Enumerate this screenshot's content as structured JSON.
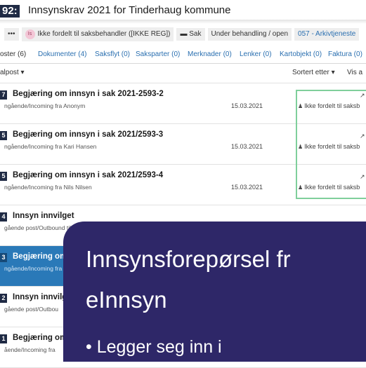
{
  "header": {
    "case_id": "92:",
    "title": "Innsynskrav 2021 for Tinderhaug kommune"
  },
  "meta": {
    "dots": "•••",
    "avatar_initials": "Is",
    "assignee": "Ikke fordelt til saksbehandler ([IKKE REG])",
    "type_icon": "folder-icon",
    "type": "Sak",
    "status": "Under behandling / open",
    "archive_code": "057 - Arkivtjeneste"
  },
  "tabs": [
    {
      "label": "oster (6)"
    },
    {
      "label": "Dokumenter (4)"
    },
    {
      "label": "Saksflyt (0)"
    },
    {
      "label": "Saksparter (0)"
    },
    {
      "label": "Merknader (0)"
    },
    {
      "label": "Lenker (0)"
    },
    {
      "label": "Kartobjekt (0)"
    },
    {
      "label": "Faktura (0)"
    }
  ],
  "toolbar": {
    "filter_label": "alpost ▾",
    "sort_label": "Sortert etter ▾",
    "view_label": "Vis a"
  },
  "rows": [
    {
      "badge": "7",
      "title": "Begjæring om innsyn i sak 2021-2593-2",
      "sub": "ngående/Incoming fra Anonym",
      "date": "15.03.2021",
      "assign": "Ikke fordelt til saksb",
      "mark": "↗"
    },
    {
      "badge": "5",
      "title": "Begjæring om innsyn i sak 2021/2593-3",
      "sub": "ngående/Incoming fra Kari Hansen",
      "date": "15.03.2021",
      "assign": "Ikke fordelt til saksb",
      "mark": "↗"
    },
    {
      "badge": "5",
      "title": "Begjæring om innsyn i sak 2021/2593-4",
      "sub": "ngående/Incoming fra Nils Nilsen",
      "date": "15.03.2021",
      "assign": "Ikke fordelt til saksb",
      "mark": "↗"
    },
    {
      "badge": "4",
      "title": "Innsyn innvilget",
      "sub": "gående post/Outbound til",
      "date": "",
      "assign": "",
      "mark": ""
    },
    {
      "badge": "3",
      "title": "Begjæring om",
      "sub": "ngående/Incoming fra",
      "date": "",
      "assign": "",
      "mark": ""
    },
    {
      "badge": "2",
      "title": "Innsyn innvilg",
      "sub": "gående post/Outbou",
      "date": "",
      "assign": "",
      "mark": ""
    },
    {
      "badge": "1",
      "title": "Begjæring om",
      "sub": "ående/Incoming fra",
      "date": "",
      "assign": "",
      "mark": ""
    }
  ],
  "overlay": {
    "title_line1": "Innsynsforepørsel fr",
    "title_line2": "eInnsyn",
    "bullet": "• Legger seg inn i"
  },
  "colors": {
    "navy_badge": "#1f2a44",
    "link_blue": "#2a6fb0",
    "selected_row": "#2a79b8",
    "highlight_border": "#7fcf9b",
    "overlay_bg": "#2e2768"
  }
}
